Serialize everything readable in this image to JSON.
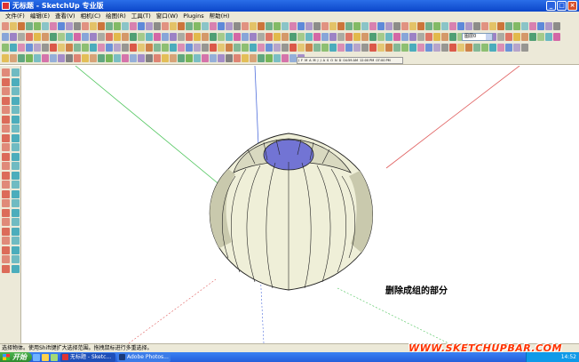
{
  "window": {
    "title": "无标题 - SketchUp 专业版",
    "buttons": [
      "_",
      "□",
      "×"
    ]
  },
  "menu": [
    "文件(F)",
    "编辑(E)",
    "查看(V)",
    "相机(C)",
    "绘图(R)",
    "工具(T)",
    "窗口(W)",
    "Plugins",
    "帮助(H)"
  ],
  "layer_select": {
    "value": "图层0"
  },
  "shadow_strip": [
    "J",
    "F",
    "M",
    "A",
    "M",
    "J",
    "J",
    "A",
    "S",
    "O",
    "N",
    "D",
    "04:59 AM",
    "12:00 PM",
    "07:00 PM"
  ],
  "annotation": "删除成组的部分",
  "status_text": "选择物体。使用Shift键扩大选择范围。拖拽鼠标进行多重选择。",
  "watermark": "WWW.SKETCHUPBAR.COM",
  "taskbar": {
    "start": "开始",
    "tasks": [
      "无标题 - Sketc...",
      "Adobe Photos..."
    ],
    "clock": "14:52"
  },
  "colors": {
    "title_blue": "#0b46c9",
    "model_face": "#efefd8",
    "model_shade": "#b8b89c",
    "opening": "#7274d4",
    "axis_red": "#e06060",
    "axis_green": "#4cc45a",
    "axis_blue": "#4f6edc",
    "watermark": "#ff3300"
  },
  "icons": [
    "select-icon",
    "eraser-icon",
    "paint-icon",
    "line-icon",
    "rectangle-icon",
    "circle-icon",
    "arc-icon",
    "polygon-icon",
    "pushpull-icon",
    "move-icon",
    "rotate-icon",
    "scale-icon",
    "offset-icon",
    "tape-icon",
    "protractor-icon",
    "text-icon",
    "axes-icon",
    "orbit-icon",
    "pan-icon",
    "zoom-icon",
    "walk-icon",
    "section-icon"
  ]
}
